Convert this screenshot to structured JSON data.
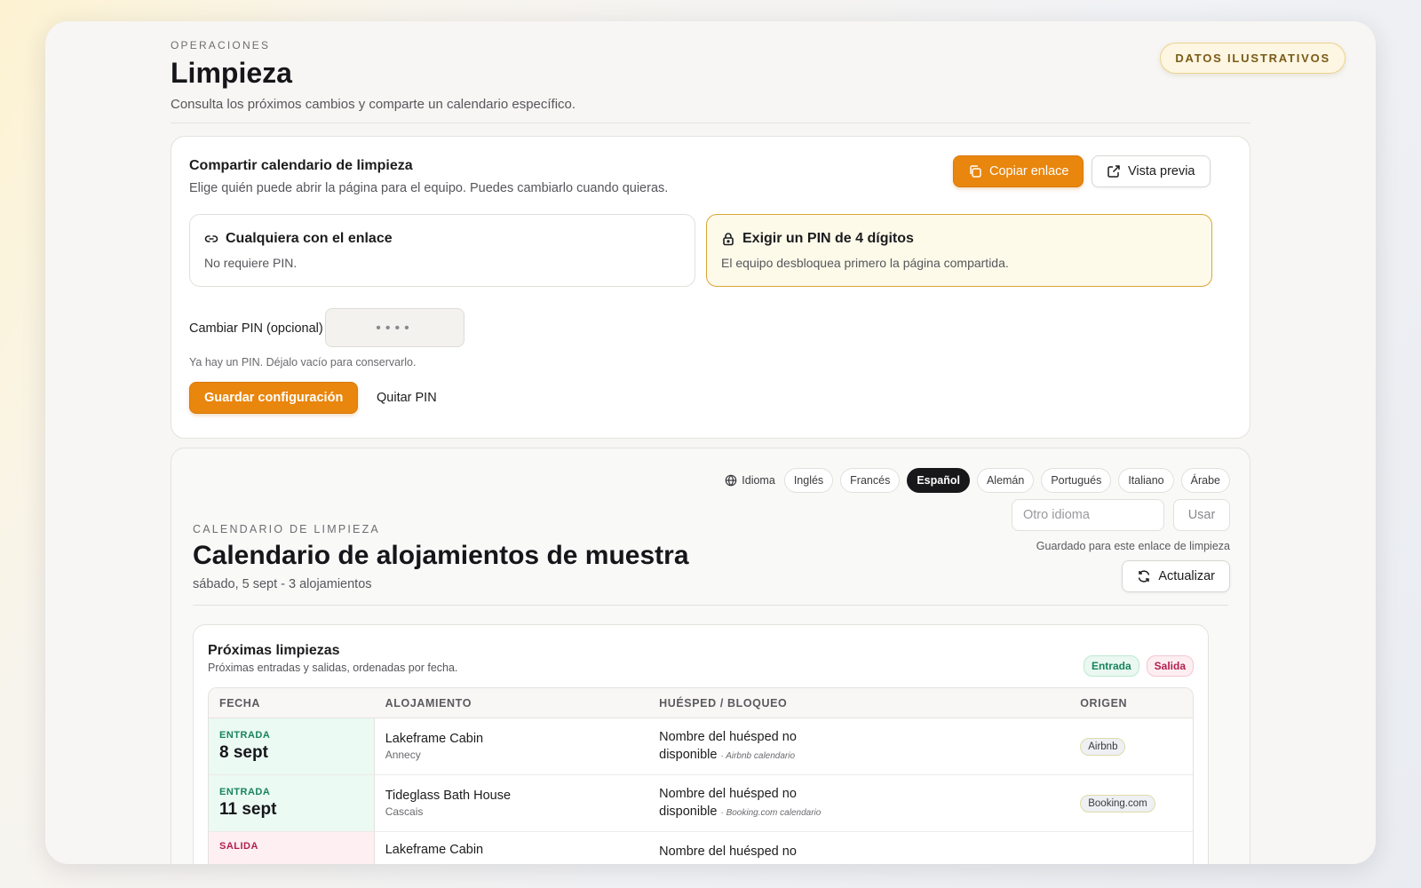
{
  "badge": "DATOS ILUSTRATIVOS",
  "header": {
    "eyebrow": "OPERACIONES",
    "title": "Limpieza",
    "subtitle": "Consulta los próximos cambios y comparte un calendario específico."
  },
  "share": {
    "title": "Compartir calendario de limpieza",
    "description": "Elige quién puede abrir la página para el equipo. Puedes cambiarlo cuando quieras.",
    "copy_label": "Copiar enlace",
    "preview_label": "Vista previa",
    "option_anyone": {
      "title": "Cualquiera con el enlace",
      "subtitle": "No requiere PIN."
    },
    "option_pin": {
      "title": "Exigir un PIN de 4 dígitos",
      "subtitle": "El equipo desbloquea primero la página compartida."
    },
    "pin_label": "Cambiar PIN (opcional)",
    "pin_placeholder": "••••",
    "pin_hint": "Ya hay un PIN. Déjalo vacío para conservarlo.",
    "save_label": "Guardar configuración",
    "remove_label": "Quitar PIN"
  },
  "calendar": {
    "language_label": "Idioma",
    "languages": [
      "Inglés",
      "Francés",
      "Español",
      "Alemán",
      "Portugués",
      "Italiano",
      "Árabe"
    ],
    "active_language": "Español",
    "other_language_placeholder": "Otro idioma",
    "use_label": "Usar",
    "saved_note": "Guardado para este enlace de limpieza",
    "refresh_label": "Actualizar",
    "eyebrow": "CALENDARIO DE LIMPIEZA",
    "title": "Calendario de alojamientos de muestra",
    "subtitle": "sábado, 5 sept - 3 alojamientos"
  },
  "upcoming": {
    "title": "Próximas limpiezas",
    "subtitle": "Próximas entradas y salidas, ordenadas por fecha.",
    "legend_in": "Entrada",
    "legend_out": "Salida",
    "columns": [
      "FECHA",
      "ALOJAMIENTO",
      "HUÉSPED / BLOQUEO",
      "ORIGEN"
    ],
    "rows": [
      {
        "kind": "ENTRADA",
        "date": "8 sept",
        "property": "Lakeframe Cabin",
        "city": "Annecy",
        "guest_line1": "Nombre del huésped no",
        "guest_line2": "disponible",
        "source_note": "· Airbnb calendario",
        "source": "Airbnb"
      },
      {
        "kind": "ENTRADA",
        "date": "11 sept",
        "property": "Tideglass Bath House",
        "city": "Cascais",
        "guest_line1": "Nombre del huésped no",
        "guest_line2": "disponible",
        "source_note": "· Booking.com calendario",
        "source": "Booking.com"
      },
      {
        "kind": "SALIDA",
        "date": "",
        "property": "Lakeframe Cabin",
        "city": "",
        "guest_line1": "Nombre del huésped no",
        "guest_line2": "",
        "source_note": "",
        "source": ""
      }
    ]
  },
  "colors": {
    "accent": "#e9860d",
    "entrada": "#17845a",
    "salida": "#b31f4d",
    "pin_border": "#d9a636"
  }
}
